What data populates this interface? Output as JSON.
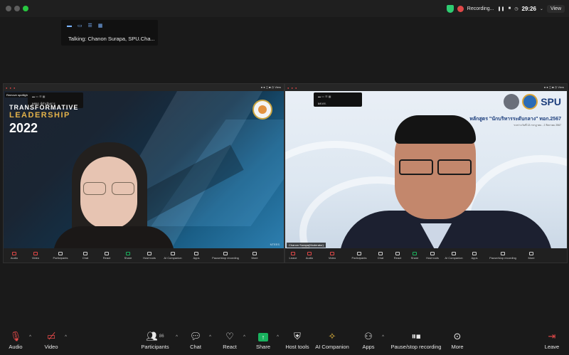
{
  "titlebar": {
    "recording_label": "Recording...",
    "timer": "29:26",
    "view_label": "View"
  },
  "talking": {
    "text": "Talking: Chanon Surapa, SPU.Cha..."
  },
  "left_panel": {
    "spotlight_tag": "Remove spotlight",
    "popup_text": "ผศดร. ผู้ดำเนินการ",
    "banner_line1": "TRANSFORMATIVE",
    "banner_line2": "LEADERSHIP",
    "banner_line3": "2022",
    "footnote": "NTEES",
    "tools": [
      "Audio",
      "Video",
      "Participants",
      "Chat",
      "React",
      "Share",
      "Host tools",
      "AI Companion",
      "Apps",
      "Pause/stop recording",
      "More"
    ]
  },
  "right_panel": {
    "popup_text": "ผศ.ดร.",
    "spu_text": "SPU",
    "course_title": "หลักสูตร \"นักบริหารระดับกลาง\" ทอก.2567",
    "course_sub": "ระหว่างวันที่ 13 กรกฎาคม - 2 สิงหาคม 2567",
    "name_tag": "Chanon Surapa(Moderator)",
    "tools": [
      "Leave",
      "Audio",
      "Video",
      "Participants",
      "Chat",
      "React",
      "Share",
      "Host tools",
      "AI Companion",
      "Apps",
      "Pause/stop recording",
      "More"
    ]
  },
  "toolbar": {
    "audio_label": "Audio",
    "video_label": "Video",
    "participants_label": "Participants",
    "participants_count": "86",
    "chat_label": "Chat",
    "react_label": "React",
    "share_label": "Share",
    "host_tools_label": "Host tools",
    "ai_label": "AI Companion",
    "apps_label": "Apps",
    "recording_label": "Pause/stop recording",
    "more_label": "More",
    "leave_label": "Leave"
  },
  "colors": {
    "accent_green": "#19b25e",
    "recording_red": "#e04848",
    "leadership_gold": "#e3b24a"
  }
}
